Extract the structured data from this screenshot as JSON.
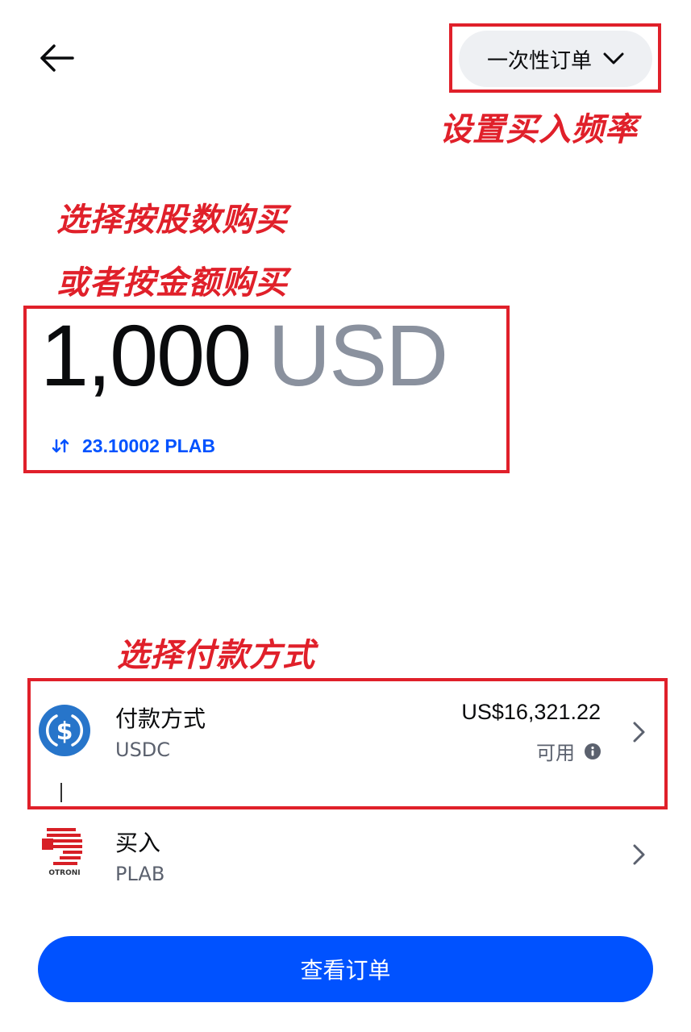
{
  "header": {
    "frequency_label": "一次性订单"
  },
  "annotations": {
    "frequency_note": "设置买入频率",
    "amount_note_line1": "选择按股数购买",
    "amount_note_line2": "或者按金额购买",
    "payment_note": "选择付款方式"
  },
  "amount": {
    "value": "1,000",
    "currency": "USD",
    "converted": "23.10002 PLAB"
  },
  "payment": {
    "title": "付款方式",
    "asset": "USDC",
    "balance": "US$16,321.22",
    "balance_note": "可用"
  },
  "buy": {
    "title": "买入",
    "asset": "PLAB",
    "logo_text": "OTRONI"
  },
  "cta": {
    "label": "查看订单"
  },
  "colors": {
    "accent": "#0052ff",
    "annotation": "#e0202a",
    "usdc": "#2775ca",
    "photronics": "#d71f26"
  }
}
